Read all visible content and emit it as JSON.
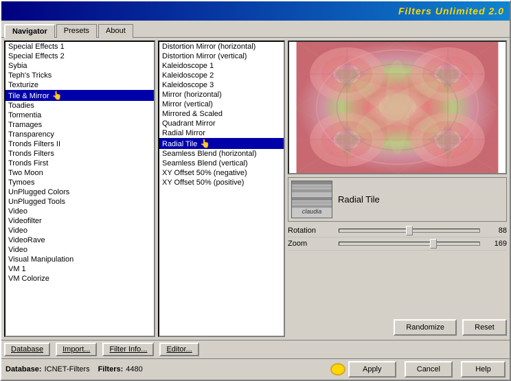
{
  "window": {
    "title": "Filters Unlimited 2.0"
  },
  "tabs": [
    {
      "id": "navigator",
      "label": "Navigator",
      "active": true
    },
    {
      "id": "presets",
      "label": "Presets",
      "active": false
    },
    {
      "id": "about",
      "label": "About",
      "active": false
    }
  ],
  "left_list": {
    "items": [
      "Special Effects 1",
      "Special Effects 2",
      "Sybia",
      "Teph's Tricks",
      "Texturize",
      "Tile & Mirror",
      "Toadies",
      "Tormentia",
      "Tramages",
      "Transparency",
      "Tronds Filters II",
      "Tronds Filters",
      "Tronds First",
      "Two Moon",
      "Tymoes",
      "UnPlugged Colors",
      "UnPlugged Tools",
      "Video",
      "Videofilter",
      "Video",
      "VideoRave",
      "Video",
      "Visual Manipulation",
      "VM 1",
      "VM Colorize"
    ],
    "selected": "Tile & Mirror"
  },
  "middle_list": {
    "items": [
      "Distortion Mirror (horizontal)",
      "Distortion Mirror (vertical)",
      "Kaleidoscope 1",
      "Kaleidoscope 2",
      "Kaleidoscope 3",
      "Mirror (horizontal)",
      "Mirror (vertical)",
      "Mirrored & Scaled",
      "Quadrant Mirror",
      "Radial Mirror",
      "Radial Tile",
      "Seamless Blend (horizontal)",
      "Seamless Blend (vertical)",
      "XY Offset 50% (negative)",
      "XY Offset 50% (positive)"
    ],
    "selected": "Radial Tile"
  },
  "filter_info": {
    "name": "Radial Tile",
    "thumbnail_text": "claudia"
  },
  "sliders": [
    {
      "label": "Rotation",
      "value": 88,
      "percent": 50
    },
    {
      "label": "Zoom",
      "value": 169,
      "percent": 67
    }
  ],
  "toolbar": {
    "database_label": "Database",
    "import_label": "Import...",
    "filter_info_label": "Filter Info...",
    "editor_label": "Editor...",
    "randomize_label": "Randomize",
    "reset_label": "Reset"
  },
  "action_buttons": {
    "apply_label": "Apply",
    "cancel_label": "Cancel",
    "help_label": "Help"
  },
  "status_bar": {
    "database_label": "Database:",
    "database_value": "ICNET-Filters",
    "filters_label": "Filters:",
    "filters_value": "4480"
  }
}
